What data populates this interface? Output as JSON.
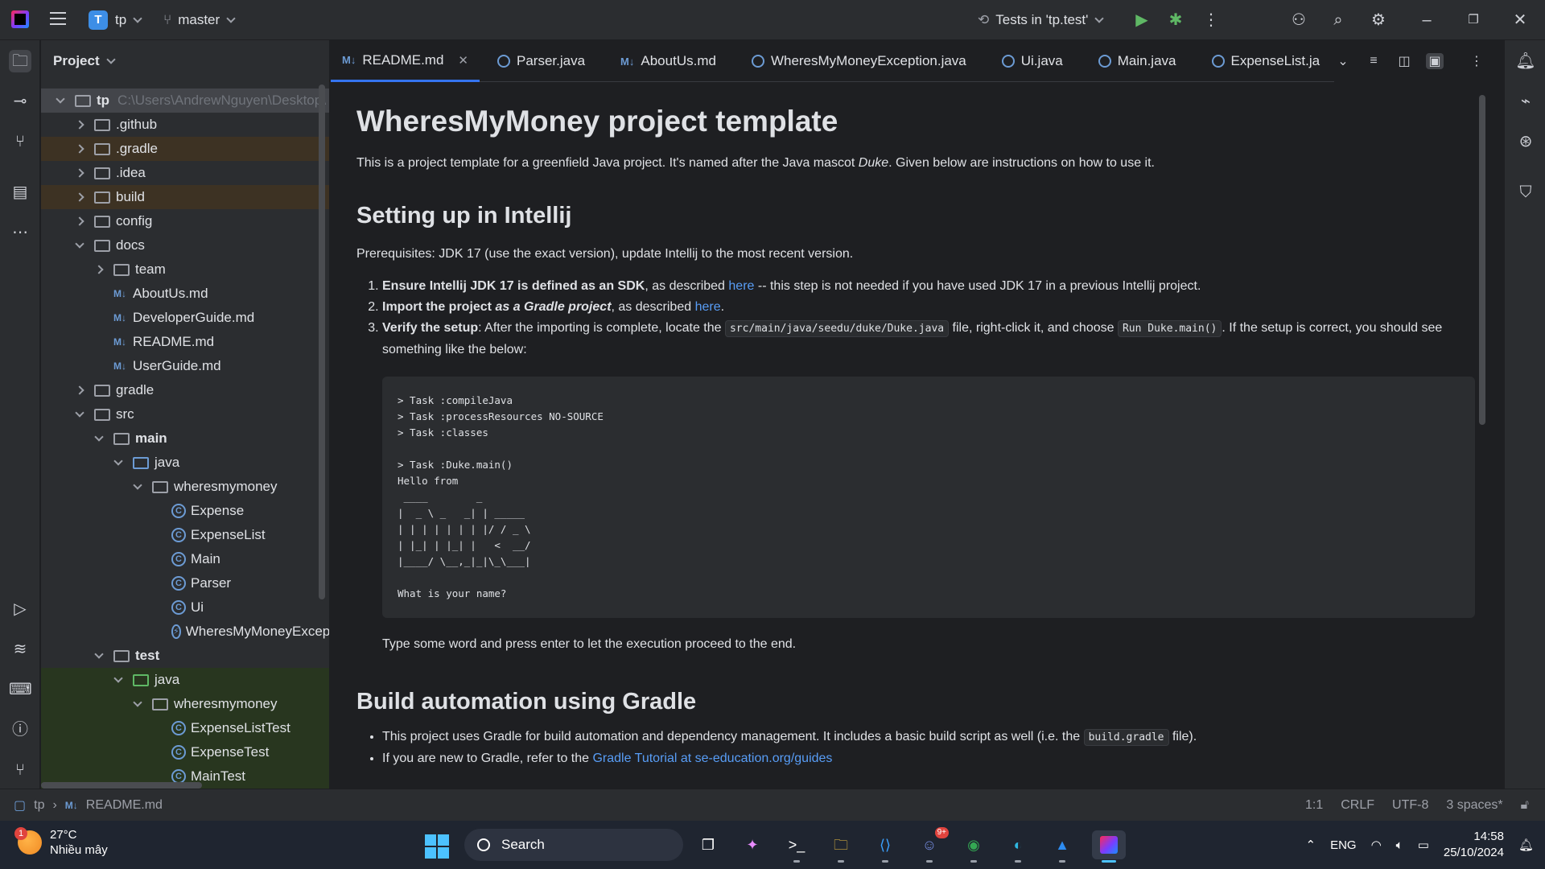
{
  "titlebar": {
    "project_initial": "T",
    "project_name": "tp",
    "branch": "master",
    "run_config": "Tests in 'tp.test'"
  },
  "project_panel": {
    "title": "Project",
    "root": {
      "name": "tp",
      "path": "C:\\Users\\AndrewNguyen\\Desktop\\"
    },
    "items": [
      {
        "label": ".github"
      },
      {
        "label": ".gradle"
      },
      {
        "label": ".idea"
      },
      {
        "label": "build"
      },
      {
        "label": "config"
      },
      {
        "label": "docs"
      },
      {
        "label": "team"
      },
      {
        "label": "AboutUs.md"
      },
      {
        "label": "DeveloperGuide.md"
      },
      {
        "label": "README.md"
      },
      {
        "label": "UserGuide.md"
      },
      {
        "label": "gradle"
      },
      {
        "label": "src"
      },
      {
        "label": "main"
      },
      {
        "label": "java"
      },
      {
        "label": "wheresmymoney"
      },
      {
        "label": "Expense"
      },
      {
        "label": "ExpenseList"
      },
      {
        "label": "Main"
      },
      {
        "label": "Parser"
      },
      {
        "label": "Ui"
      },
      {
        "label": "WheresMyMoneyException"
      },
      {
        "label": "test"
      },
      {
        "label": "java"
      },
      {
        "label": "wheresmymoney"
      },
      {
        "label": "ExpenseListTest"
      },
      {
        "label": "ExpenseTest"
      },
      {
        "label": "MainTest"
      }
    ]
  },
  "tabs": [
    {
      "label": "README.md",
      "kind": "md"
    },
    {
      "label": "Parser.java",
      "kind": "class"
    },
    {
      "label": "AboutUs.md",
      "kind": "md"
    },
    {
      "label": "WheresMyMoneyException.java",
      "kind": "class"
    },
    {
      "label": "Ui.java",
      "kind": "class"
    },
    {
      "label": "Main.java",
      "kind": "class"
    },
    {
      "label": "ExpenseList.ja",
      "kind": "class"
    }
  ],
  "markdown": {
    "h1": "WheresMyMoney project template",
    "intro_a": "This is a project template for a greenfield Java project. It's named after the Java mascot ",
    "intro_em": "Duke",
    "intro_b": ". Given below are instructions on how to use it.",
    "h2_setup": "Setting up in Intellij",
    "prereq": "Prerequisites: JDK 17 (use the exact version), update Intellij to the most recent version.",
    "step1_bold": "Ensure Intellij JDK 17 is defined as an SDK",
    "step1_a": ", as described ",
    "step1_link": "here",
    "step1_b": " -- this step is not needed if you have used JDK 17 in a previous Intellij project.",
    "step2_bold": "Import the project ",
    "step2_bolditalic": "as a Gradle project",
    "step2_a": ", as described ",
    "step2_link": "here",
    "step2_b": ".",
    "step3_bold": "Verify the setup",
    "step3_a": ": After the importing is complete, locate the ",
    "step3_code1": "src/main/java/seedu/duke/Duke.java",
    "step3_b": " file, right-click it, and choose ",
    "step3_code2": "Run Duke.main()",
    "step3_c": ". If the setup is correct, you should see something like the below:",
    "codeblock": "> Task :compileJava\n> Task :processResources NO-SOURCE\n> Task :classes\n\n> Task :Duke.main()\nHello from\n ____        _\n|  _ \\ _   _| | _____\n| | | | | | | |/ / _ \\\n| |_| | |_| |   <  __/\n|____/ \\__,_|_|\\_\\___|\n\nWhat is your name?",
    "after_code": "Type some word and press enter to let the execution proceed to the end.",
    "h2_build": "Build automation using Gradle",
    "bullet1_a": "This project uses Gradle for build automation and dependency management. It includes a basic build script as well (i.e. the ",
    "bullet1_code": "build.gradle",
    "bullet1_b": " file).",
    "bullet2_a": "If you are new to Gradle, refer to the ",
    "bullet2_link": "Gradle Tutorial at se-education.org/guides"
  },
  "statusbar": {
    "crumb_project": "tp",
    "crumb_file": "README.md",
    "position": "1:1",
    "line_sep": "CRLF",
    "encoding": "UTF-8",
    "indent": "3 spaces*"
  },
  "taskbar": {
    "weather_temp": "27°C",
    "weather_desc": "Nhiều mây",
    "weather_badge": "1",
    "search": "Search",
    "discord_badge": "9+",
    "lang": "ENG",
    "time": "14:58",
    "date": "25/10/2024"
  }
}
